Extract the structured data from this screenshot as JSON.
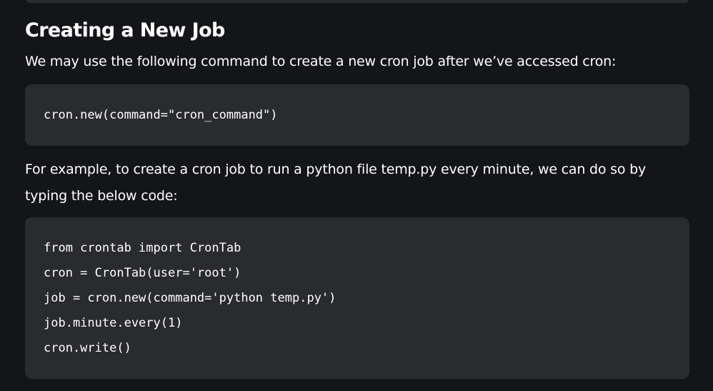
{
  "article": {
    "heading": "Creating a New Job",
    "intro": "We may use the following command to create a new cron job after we’ve accessed cron:",
    "code_1": [
      "cron.new(command=\"cron_command\")"
    ],
    "example_text": "For example, to create a cron job to run a python file temp.py every minute, we can do so by typing the below code:",
    "code_2": [
      "from crontab import CronTab",
      "cron = CronTab(user='root')",
      "job = cron.new(command='python temp.py')",
      "job.minute.every(1)",
      "cron.write()"
    ]
  }
}
